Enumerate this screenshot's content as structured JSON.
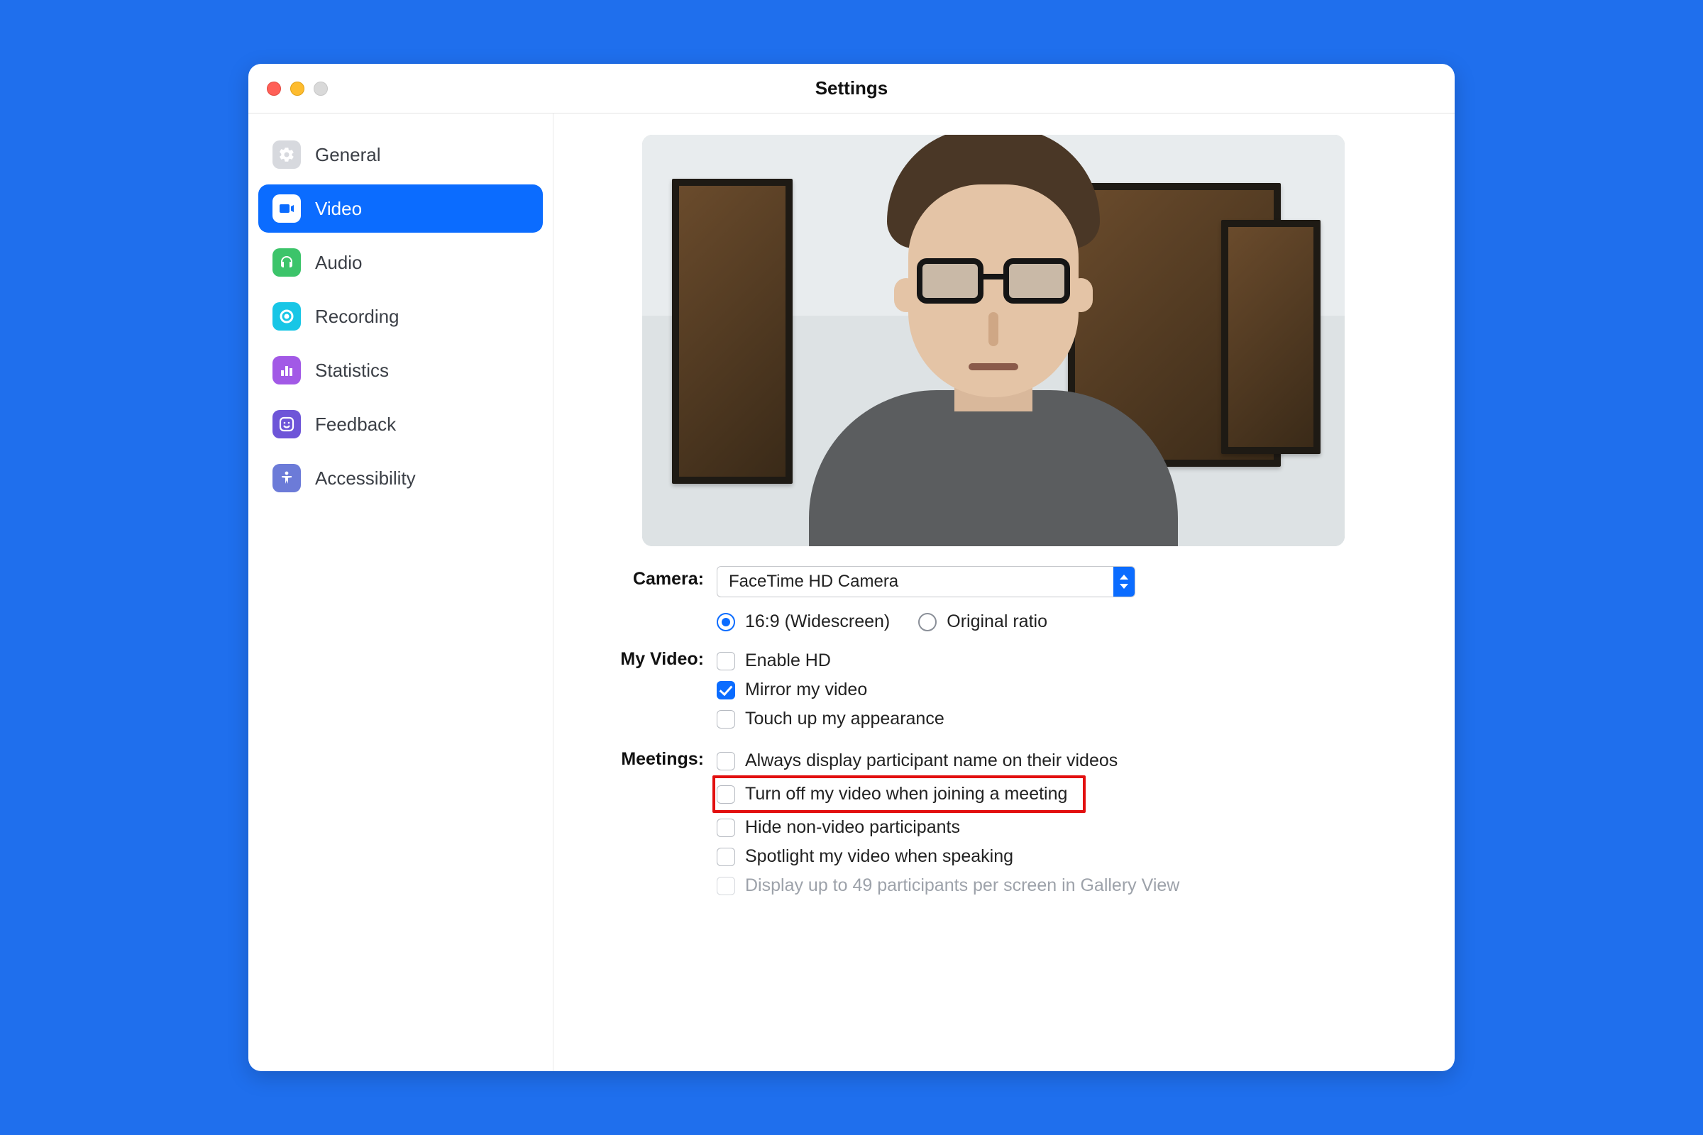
{
  "window": {
    "title": "Settings"
  },
  "sidebar": {
    "items": [
      {
        "label": "General",
        "icon": "gear-icon"
      },
      {
        "label": "Video",
        "icon": "video-icon",
        "active": true
      },
      {
        "label": "Audio",
        "icon": "headphones-icon"
      },
      {
        "label": "Recording",
        "icon": "record-icon"
      },
      {
        "label": "Statistics",
        "icon": "bar-chart-icon"
      },
      {
        "label": "Feedback",
        "icon": "smile-icon"
      },
      {
        "label": "Accessibility",
        "icon": "person-icon"
      }
    ]
  },
  "video": {
    "camera_label": "Camera:",
    "camera_selected": "FaceTime HD Camera",
    "ratio_widescreen": "16:9 (Widescreen)",
    "ratio_original": "Original ratio",
    "ratio_selected": "widescreen",
    "my_video_label": "My Video:",
    "enable_hd": {
      "label": "Enable HD",
      "checked": false
    },
    "mirror": {
      "label": "Mirror my video",
      "checked": true
    },
    "touch_up": {
      "label": "Touch up my appearance",
      "checked": false
    },
    "meetings_label": "Meetings:",
    "always_display_name": {
      "label": "Always display participant name on their videos",
      "checked": false
    },
    "turn_off_video_join": {
      "label": "Turn off my video when joining a meeting",
      "checked": false,
      "highlighted": true
    },
    "hide_non_video": {
      "label": "Hide non-video participants",
      "checked": false
    },
    "spotlight_speaking": {
      "label": "Spotlight my video when speaking",
      "checked": false
    },
    "display_49": {
      "label": "Display up to 49 participants per screen in Gallery View",
      "checked": false,
      "disabled": true
    }
  }
}
